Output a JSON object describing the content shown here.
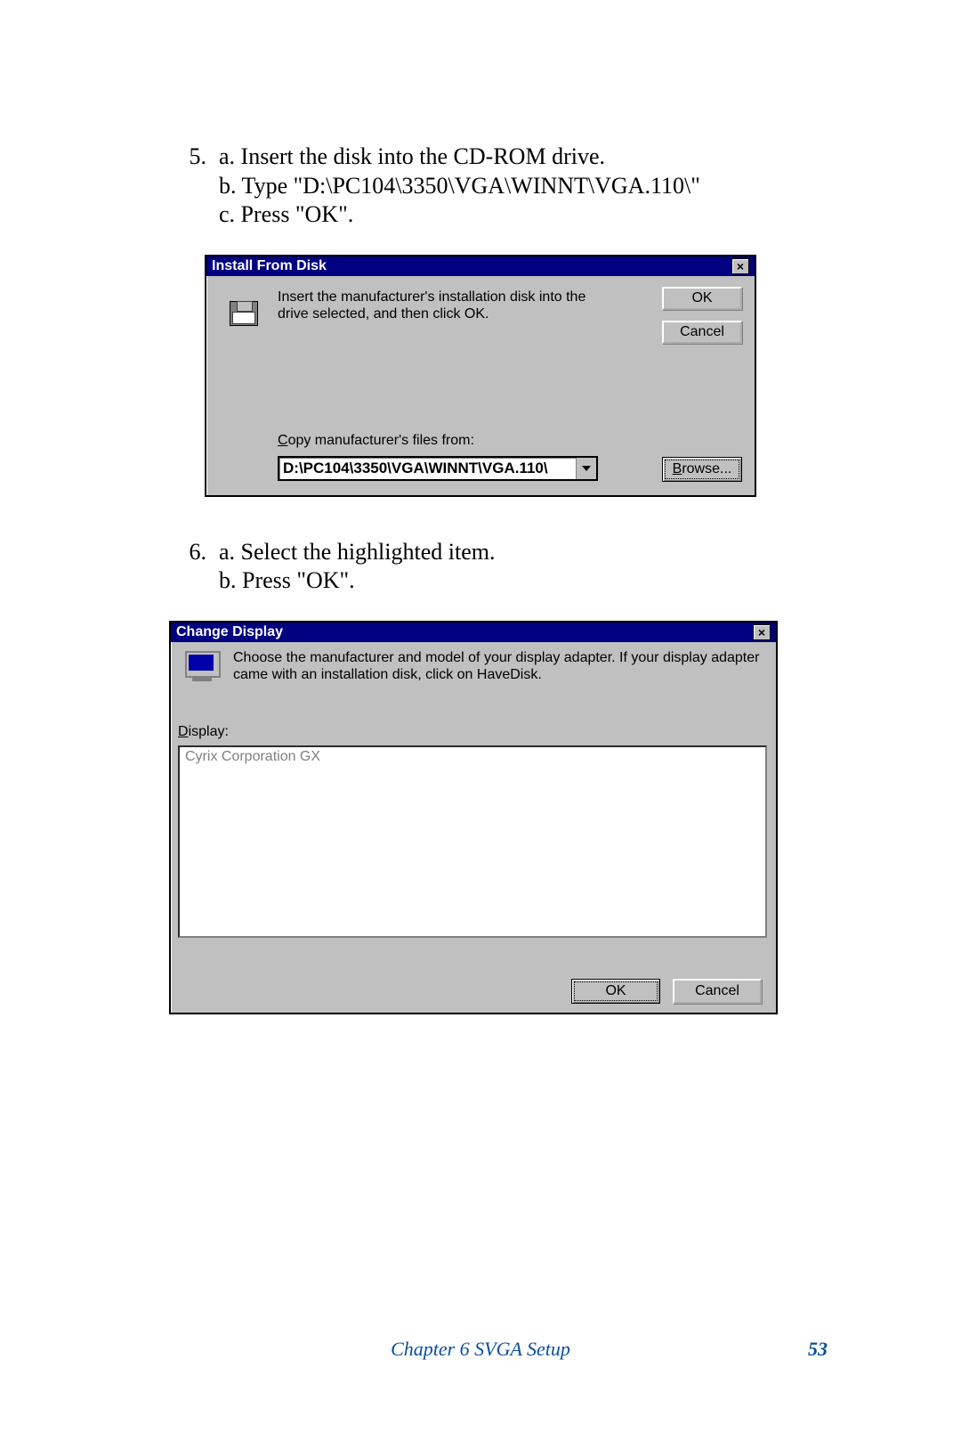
{
  "steps": {
    "s5": {
      "num": "5.",
      "a": "a. Insert the disk into the CD-ROM drive.",
      "b": "b. Type \"D:\\PC104\\3350\\VGA\\WINNT\\VGA.110\\\"",
      "c": "c. Press \"OK\"."
    },
    "s6": {
      "num": "6.",
      "a": "a. Select the highlighted item.",
      "b": "b. Press \"OK\"."
    }
  },
  "dialog1": {
    "title": "Install From Disk",
    "message": "Insert the manufacturer's installation disk into the drive selected, and then click OK.",
    "ok_label": "OK",
    "cancel_label": "Cancel",
    "copy_label": "Copy manufacturer's files from:",
    "path_value": "D:\\PC104\\3350\\VGA\\WINNT\\VGA.110\\",
    "browse_label": "Browse..."
  },
  "dialog2": {
    "title": "Change Display",
    "message": "Choose the manufacturer and model of your display adapter.  If your display adapter came with an installation disk, click on HaveDisk.",
    "display_label": "Display:",
    "list_item": "Cyrix Corporation GX",
    "ok_label": "OK",
    "cancel_label": "Cancel"
  },
  "footer": {
    "chapter": "Chapter 6   SVGA Setup",
    "page": "53"
  },
  "glyphs": {
    "dropdown": "▼",
    "close": "×",
    "hot_C": "C",
    "hot_D": "D",
    "hot_B": "B"
  }
}
